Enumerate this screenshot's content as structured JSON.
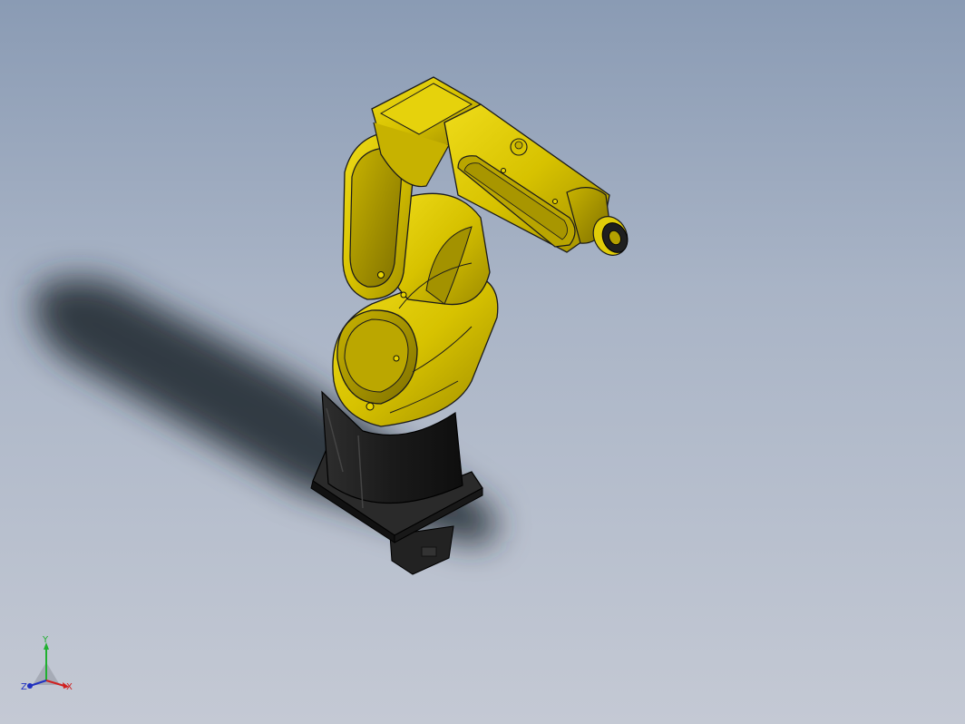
{
  "viewport": {
    "background_top": "#8a9bb4",
    "background_bottom": "#c4c9d4"
  },
  "model": {
    "body_color": "#d4c100",
    "base_color": "#1c1c1c",
    "edge_color": "#1a1a1a",
    "shadow_color": "#2a2f36"
  },
  "triad": {
    "y_label": "Y",
    "x_label": "X",
    "z_label": "Z",
    "y_color": "#20b030",
    "x_color": "#d02020",
    "z_color": "#2030c0"
  }
}
